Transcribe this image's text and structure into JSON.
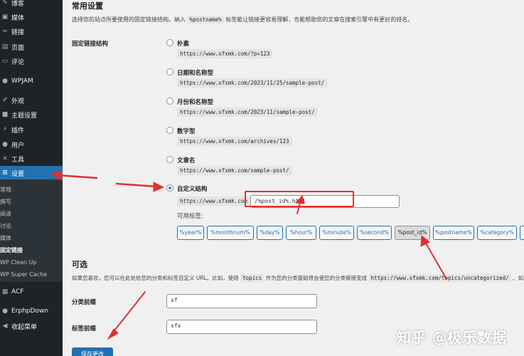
{
  "sidebar": {
    "items": [
      {
        "label": "博客",
        "icon": "blog-icon"
      },
      {
        "label": "媒体",
        "icon": "media-icon"
      },
      {
        "label": "链接",
        "icon": "link-icon"
      },
      {
        "label": "页面",
        "icon": "page-icon"
      },
      {
        "label": "评论",
        "icon": "comment-icon"
      },
      {
        "label": "WPJAM",
        "icon": "wpjam-icon"
      },
      {
        "label": "外观",
        "icon": "appearance-icon"
      },
      {
        "label": "主题设置",
        "icon": "theme-settings-icon"
      },
      {
        "label": "插件",
        "icon": "plugin-icon"
      },
      {
        "label": "用户",
        "icon": "user-icon"
      },
      {
        "label": "工具",
        "icon": "tool-icon"
      },
      {
        "label": "设置",
        "icon": "settings-icon",
        "active": true
      }
    ],
    "submenu": [
      "常规",
      "撰写",
      "阅读",
      "讨论",
      "媒体",
      "固定链接",
      "WP Clean Up",
      "WP Super Cache"
    ],
    "bottom_items": [
      {
        "label": "ACF",
        "icon": "acf-icon"
      },
      {
        "label": "ErphpDown",
        "icon": "erphpdown-icon"
      },
      {
        "label": "收起菜单",
        "icon": "collapse-menu-icon"
      }
    ]
  },
  "main": {
    "common_title": "常用设置",
    "common_desc_before": "选择您的站点所要使用的固定链接结构。纳入",
    "common_desc_code": "%postname%",
    "common_desc_after": "标签能让链接更容易理解，也能帮助您的文章在搜索引擎中有更好的排名。",
    "structure_label": "固定链接结构",
    "options": [
      {
        "label": "朴素",
        "example": "https://www.xfxmk.com/?p=123"
      },
      {
        "label": "日期和名称型",
        "example": "https://www.xfxmk.com/2023/11/25/sample-post/"
      },
      {
        "label": "月份和名称型",
        "example": "https://www.xfxmk.com/2023/11/sample-post/"
      },
      {
        "label": "数字型",
        "example": "https://www.xfxmk.com/archives/123"
      },
      {
        "label": "文章名",
        "example": "https://www.xfxmk.com/sample-post/"
      },
      {
        "label": "自定义结构",
        "checked": true
      }
    ],
    "custom_prefix": "https://www.xfxmk.com",
    "custom_value": "/%post_id%.html",
    "available_tags_label": "可用标签:",
    "tags": [
      "%year%",
      "%monthnum%",
      "%day%",
      "%hour%",
      "%minute%",
      "%second%",
      "%post_id%",
      "%postname%",
      "%category%"
    ],
    "selected_tag": "%post_id%",
    "optional_title": "可选",
    "optional_desc_before": "如果您喜欢，您可以在此处给您的分类和标签自定义 URL。比如，使用",
    "optional_desc_code1": "topics",
    "optional_desc_mid": "作为您的分类基础将会使您的分类链接变成",
    "optional_desc_code2": "https://www.xfxmk.com/topics/uncategorized/",
    "optional_desc_after": "。如果",
    "category_base_label": "分类前缀",
    "category_base_value": "xf",
    "tag_base_label": "标签前缀",
    "tag_base_value": "xfx",
    "submit_label": "保存更改"
  },
  "watermark": "知乎 @极乐数据",
  "colors": {
    "accent": "#2271b1",
    "sidebar": "#1d2327",
    "annotation_red": "#e03131"
  }
}
